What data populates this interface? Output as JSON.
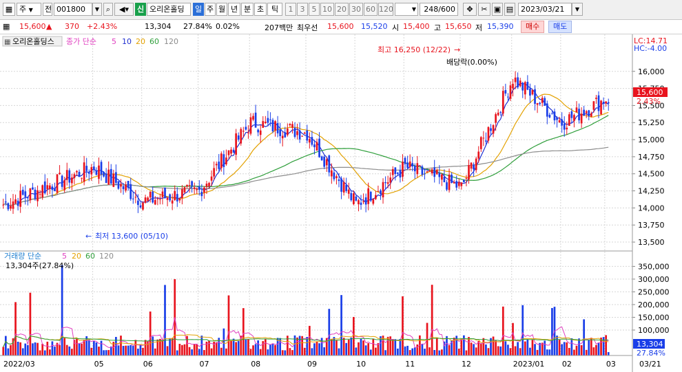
{
  "toolbar": {
    "market_type": "주",
    "period_type": "전",
    "stock_code": "001800",
    "badge_new": "신",
    "stock_name": "오리온홀딩",
    "periods": [
      "일",
      "주",
      "월",
      "년",
      "분",
      "초",
      "틱"
    ],
    "active_period": "일",
    "tick_options": [
      "1",
      "3",
      "5",
      "10",
      "20",
      "30",
      "60",
      "120"
    ],
    "bar_count": "248/600",
    "date": "2023/03/21"
  },
  "quote": {
    "price": "15,600",
    "change_arrow": "▲",
    "change": "370",
    "change_pct": "+2.43%",
    "volume": "13,304",
    "volume_ratio": "27.84%",
    "turnover_pct": "0.02%",
    "value": "207백만",
    "best_label": "최우선",
    "ask": "15,600",
    "bid": "15,520",
    "open_label": "시",
    "open": "15,400",
    "high_label": "고",
    "high": "15,650",
    "low_label": "저",
    "low": "15,390",
    "buy_button": "매수",
    "sell_button": "매도"
  },
  "price_panel": {
    "title": "오리온홀딩스",
    "legend_label": "종가 단순",
    "ma_periods": [
      "5",
      "10",
      "20",
      "60",
      "120"
    ],
    "lc": "LC:14.71",
    "hc": "HC:-4.00",
    "current_price_box": "15,600",
    "current_pct_box": "2.43%",
    "high_annotation": "최고 16,250 (12/22)",
    "low_annotation": "최저 13,600 (05/10)",
    "dividend_annotation": "배당락(0.00%)"
  },
  "volume_panel": {
    "legend_label": "거래량 단순",
    "ma_periods": [
      "5",
      "20",
      "60",
      "120"
    ],
    "current": "13,304주(27.84%)",
    "current_box": "13,304",
    "current_pct_box": "27.84%"
  },
  "colors": {
    "up": "#e8141e",
    "down": "#1a3ee8",
    "ma5": "#1f2fd0",
    "ma10": "#1f2fd0",
    "ma20": "#e3a100",
    "ma60": "#2e9e3a",
    "ma120": "#8c8c8c",
    "vol_ma5": "#e040c0"
  },
  "chart_data": [
    {
      "type": "candlestick",
      "title": "오리온홀딩스",
      "x_ticks": [
        "2022/03",
        "05",
        "06",
        "07",
        "08",
        "09",
        "10",
        "11",
        "12",
        "2023/01",
        "02",
        "03"
      ],
      "x_end_label": "03/21",
      "y_ticks": [
        13500,
        13750,
        14000,
        14250,
        14500,
        14750,
        15000,
        15250,
        15500,
        15750,
        16000
      ],
      "ylim": [
        13420,
        16360
      ],
      "annotations": [
        {
          "text": "최고 16,250 (12/22)",
          "date": "2022/12/22",
          "value": 16250
        },
        {
          "text": "최저 13,600 (05/10)",
          "date": "2022/05/10",
          "value": 13600
        }
      ],
      "series": [
        {
          "name": "종가",
          "approx_monthly_close": [
            {
              "date": "2022/03",
              "close": 14050
            },
            {
              "date": "2022/04",
              "close": 14600
            },
            {
              "date": "2022/05",
              "close": 14100
            },
            {
              "date": "2022/06",
              "close": 14250
            },
            {
              "date": "2022/07",
              "close": 15250
            },
            {
              "date": "2022/08",
              "close": 15100
            },
            {
              "date": "2022/09",
              "close": 14050
            },
            {
              "date": "2022/10",
              "close": 14600
            },
            {
              "date": "2022/11",
              "close": 14300
            },
            {
              "date": "2022/12",
              "close": 15900
            },
            {
              "date": "2023/01",
              "close": 15250
            },
            {
              "date": "2023/02",
              "close": 15600
            },
            {
              "date": "2023/03",
              "close": 15600
            }
          ]
        }
      ]
    },
    {
      "type": "bar",
      "title": "거래량",
      "y_ticks": [
        100000,
        150000,
        200000,
        250000,
        300000,
        350000
      ],
      "ylim": [
        0,
        370000
      ],
      "last_value": 13304
    }
  ]
}
